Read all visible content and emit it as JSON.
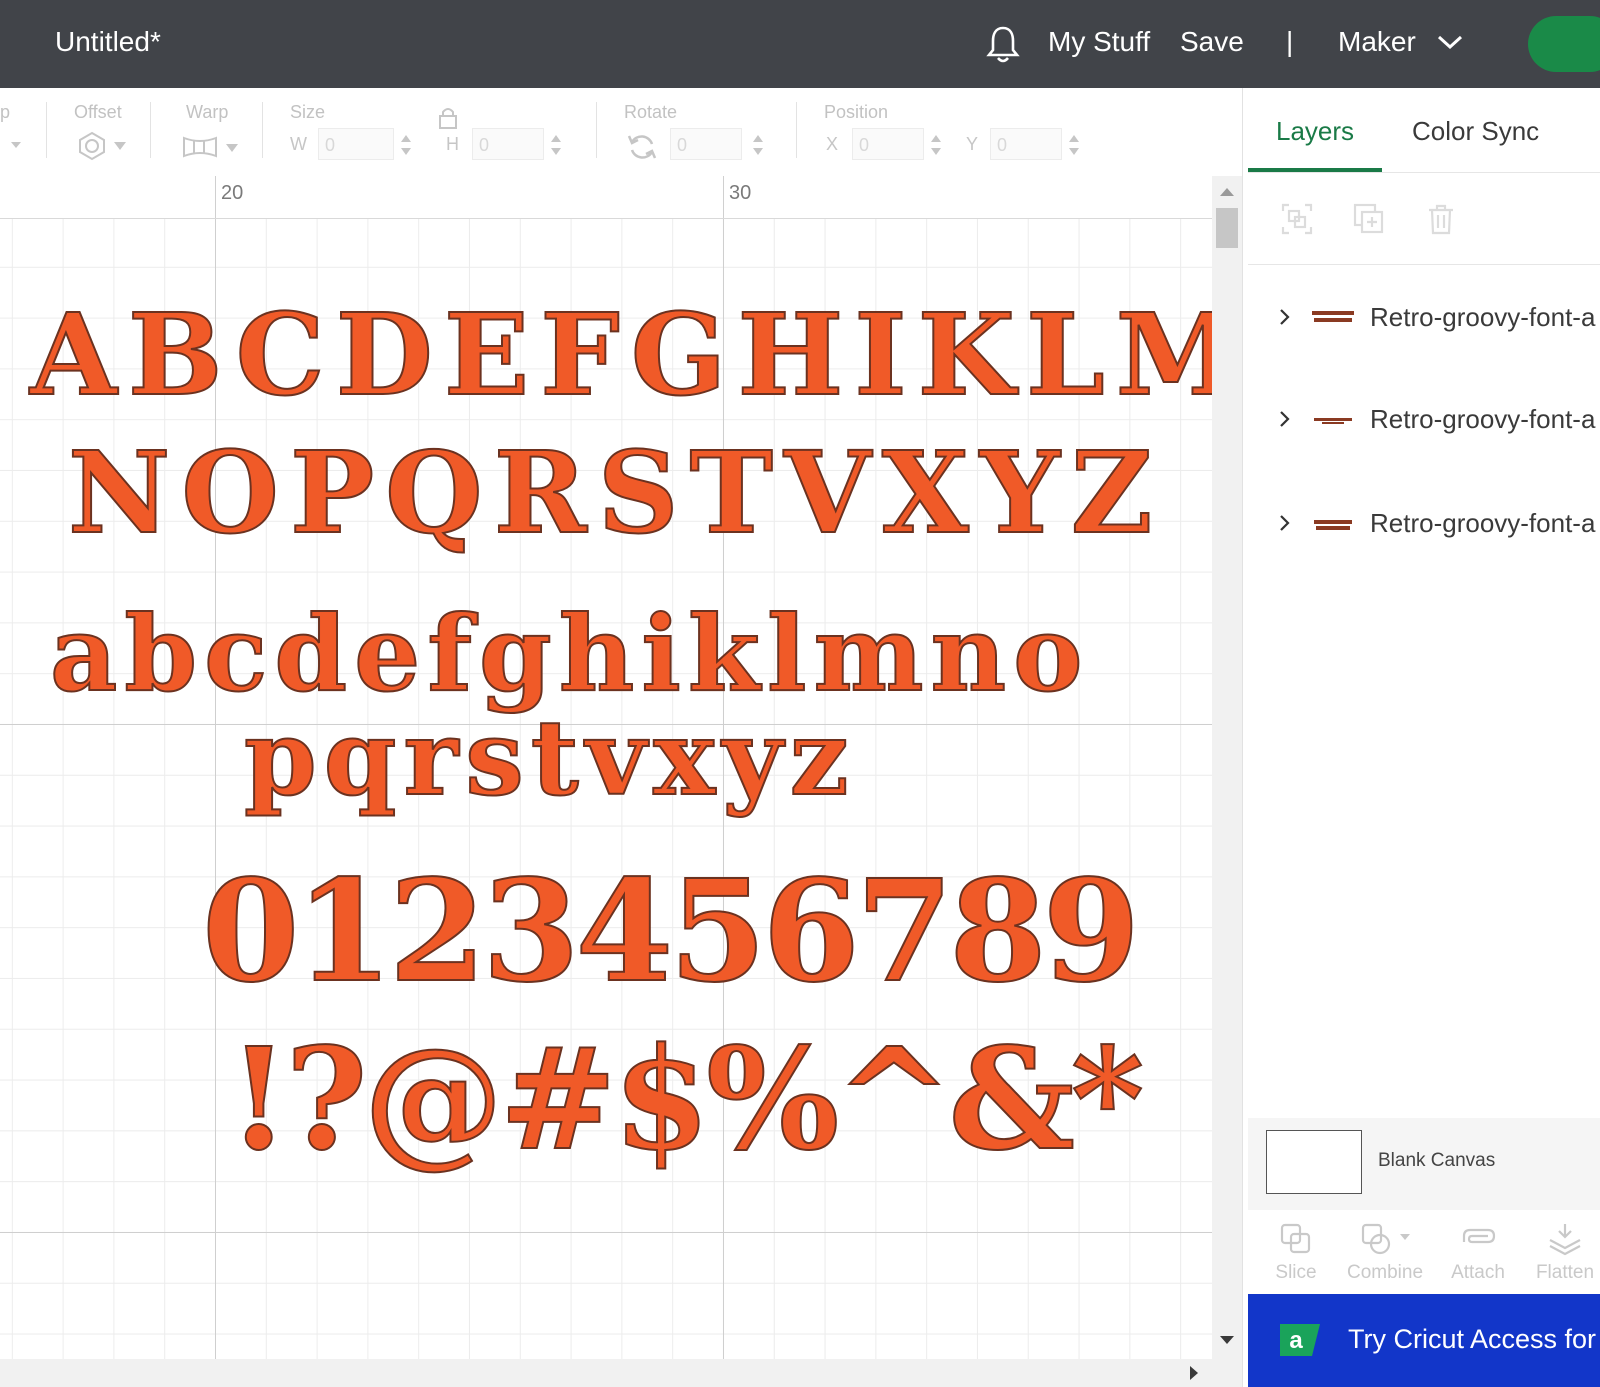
{
  "header": {
    "title": "Untitled*",
    "my_stuff": "My Stuff",
    "save": "Save",
    "separator": "|",
    "machine": "Maker"
  },
  "toolbar": {
    "wrap_label_partial": "p",
    "offset_label": "Offset",
    "warp_label": "Warp",
    "size_label": "Size",
    "w_letter": "W",
    "w_value": "0",
    "h_letter": "H",
    "h_value": "0",
    "rotate_label": "Rotate",
    "rotate_value": "0",
    "position_label": "Position",
    "x_letter": "X",
    "x_value": "0",
    "y_letter": "Y",
    "y_value": "0"
  },
  "ruler": {
    "mark_20": "20",
    "mark_30": "30"
  },
  "canvas": {
    "uppercase_1": "ABCDEFGHIKLM",
    "uppercase_2": "NOPQRSTVXYZ",
    "lowercase_1": "abcdefghiklmno",
    "lowercase_2": "pqrstvxyz",
    "numbers": "0123456789",
    "symbols": "!?@#$%^&*",
    "glyph_color": "#f05a28"
  },
  "panel": {
    "tab_layers": "Layers",
    "tab_color_sync": "Color Sync",
    "layers": [
      {
        "name": "Retro-groovy-font-a"
      },
      {
        "name": "Retro-groovy-font-a"
      },
      {
        "name": "Retro-groovy-font-a"
      }
    ],
    "blank_canvas": "Blank Canvas",
    "actions": {
      "slice": "Slice",
      "combine": "Combine",
      "attach": "Attach",
      "flatten": "Flatten"
    },
    "promo_text": "Try Cricut Access for",
    "promo_letter": "a"
  },
  "colors": {
    "header_bg": "#414449",
    "accent_green": "#1a7a47",
    "promo_blue": "#1236c9"
  }
}
